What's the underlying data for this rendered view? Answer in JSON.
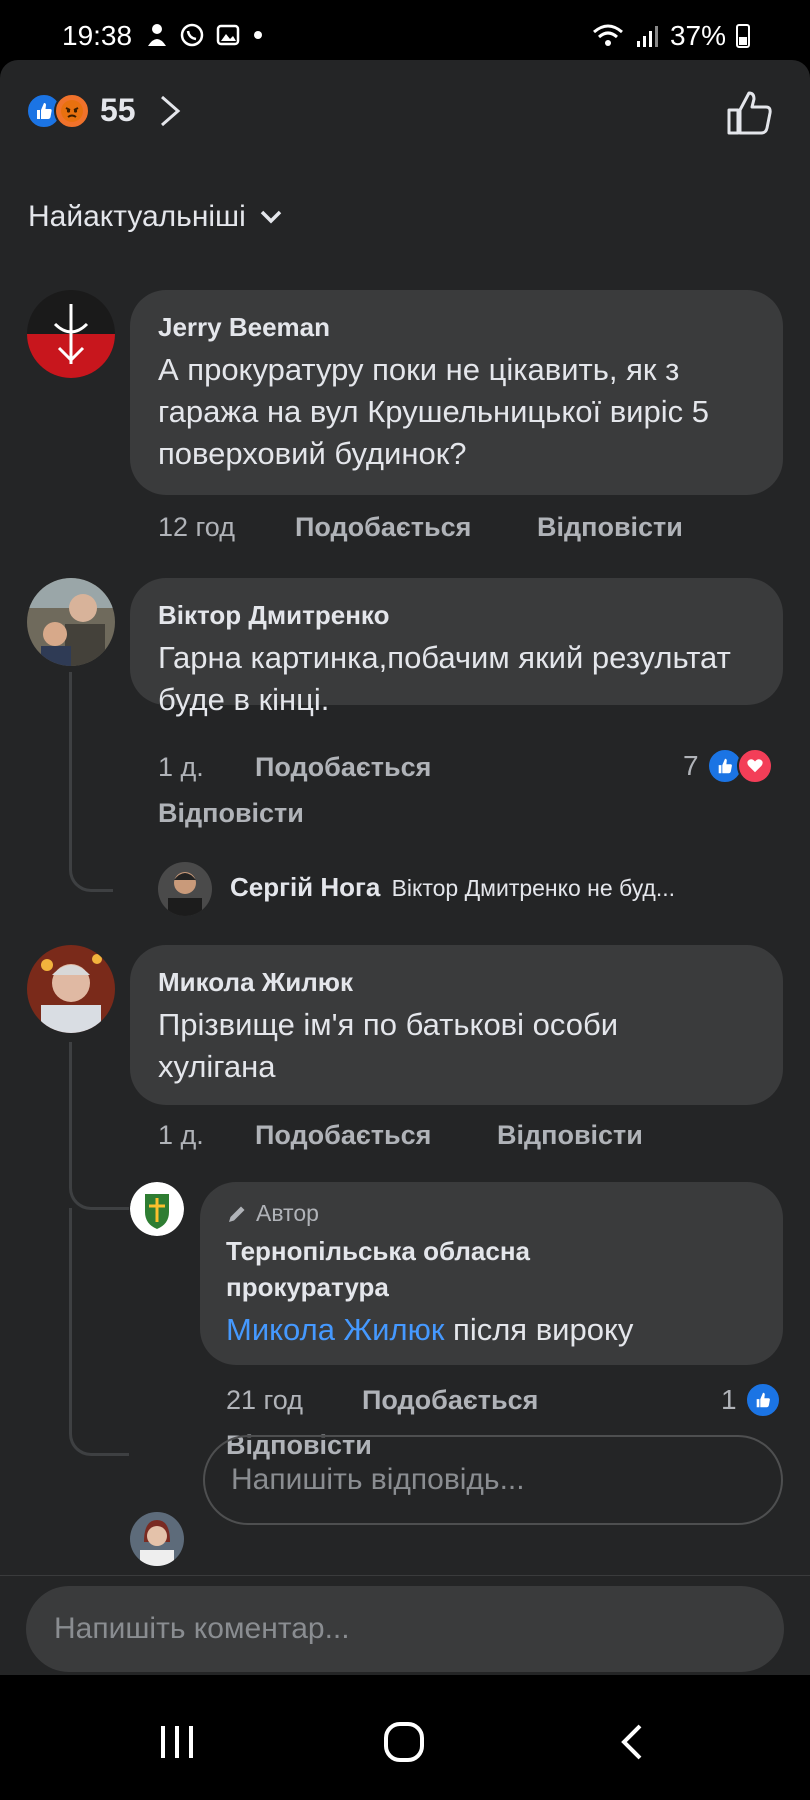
{
  "status_bar": {
    "time": "19:38",
    "battery": "37%"
  },
  "reactions": {
    "count": "55"
  },
  "sort": {
    "label": "Найактуальніші"
  },
  "comments": [
    {
      "author": "Jerry Beeman",
      "text": "А прокуратуру поки не цікавить, як з гаража на вул Крушельницької виріс 5 поверховий будинок?",
      "time": "12 год",
      "like_label": "Подобається",
      "reply_label": "Відповісти"
    },
    {
      "author": "Віктор Дмитренко",
      "text": "Гарна картинка,побачим який результат буде в кінці.",
      "time": "1 д.",
      "like_label": "Подобається",
      "reply_label": "Відповісти",
      "reaction_count": "7",
      "reply_preview": {
        "author": "Сергій Нога",
        "text": "Віктор Дмитренко не буд..."
      }
    },
    {
      "author": "Микола Жилюк",
      "text": "Прізвище ім'я по батькові особи хулігана",
      "time": "1 д.",
      "like_label": "Подобається",
      "reply_label": "Відповісти",
      "reply": {
        "badge": "Автор",
        "author": "Тернопільська обласна прокуратура",
        "mention": "Микола Жилюк",
        "text": "після вироку",
        "time": "21 год",
        "like_label": "Подобається",
        "reply_label": "Відповісти",
        "reaction_count": "1"
      }
    }
  ],
  "reply_input": {
    "placeholder": "Напишіть відповідь..."
  },
  "comment_input": {
    "placeholder": "Напишіть коментар..."
  },
  "colors": {
    "background": "#242526",
    "bubble": "#3a3b3c",
    "accent": "#1b74e4",
    "link": "#4599ff",
    "secondary_text": "#b0b3b8"
  }
}
